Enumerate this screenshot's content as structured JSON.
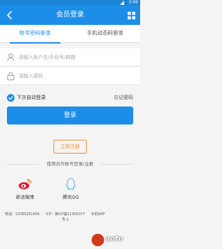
{
  "status_bar": {
    "time": "3:09"
  },
  "header": {
    "title": "会员登录",
    "back_icon": "chevron-left-icon",
    "menu_icon": "grid-icon"
  },
  "tabs": [
    {
      "label": "账号密码登录",
      "active": true
    },
    {
      "label": "手机动态码登录",
      "active": false
    }
  ],
  "form": {
    "username": {
      "placeholder": "请输入账户名/手机号/邮箱",
      "value": ""
    },
    "password": {
      "placeholder": "请输入密码",
      "value": ""
    },
    "auto_login_label": "下次自动登录",
    "auto_login_checked": true,
    "forgot_label": "忘记密码",
    "login_label": "登录",
    "register_label": "立即注册"
  },
  "partner": {
    "heading": "使用合作账号登录/注册",
    "items": [
      {
        "name": "新浪微博",
        "icon": "weibo-icon"
      },
      {
        "name": "腾讯QQ",
        "icon": "qq-icon"
      }
    ]
  },
  "footer": {
    "phone": "电话：13785251604",
    "icp": "ICP：冀ICP备11305377",
    "app": "手机APP",
    "line2": "号-1"
  },
  "colors": {
    "primary": "#1c8ee8",
    "accent": "#f08c36",
    "statusbar": "#1b84d6"
  },
  "watermark": {
    "text": "aotn",
    "icon": "aotn-logo-icon"
  }
}
